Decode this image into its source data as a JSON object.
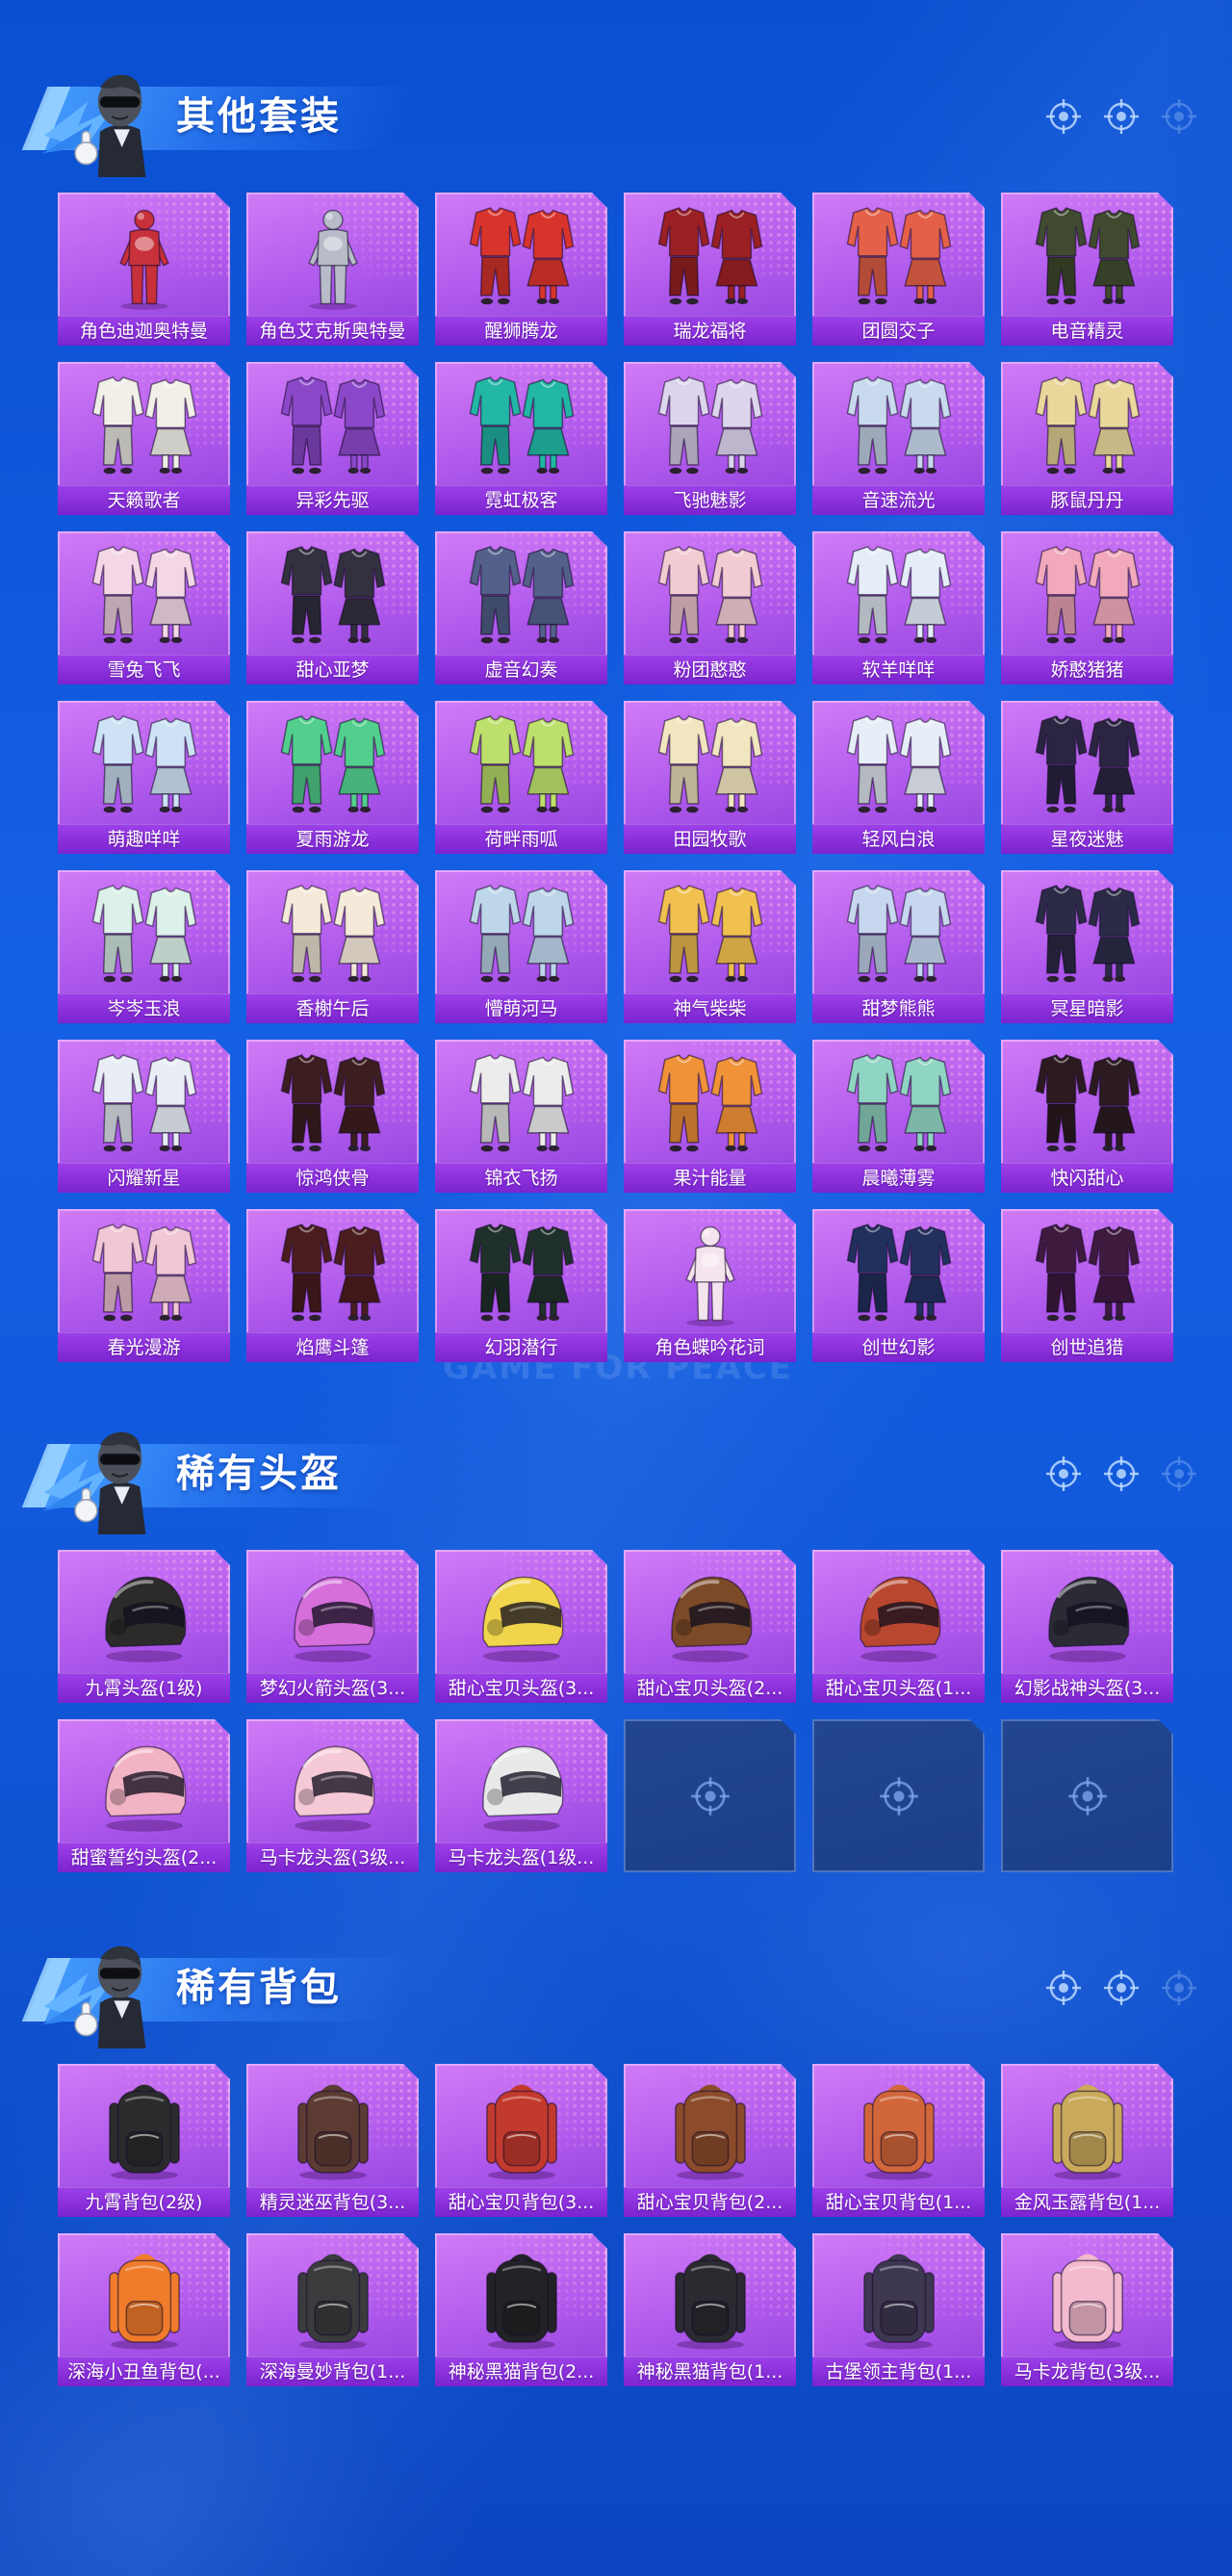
{
  "watermark": "GAME FOR PEACE",
  "colors": {
    "page_bg_top": "#0b4fd1",
    "page_bg_bottom": "#0c46c0",
    "card_top": "#d07bf6",
    "card_bottom": "#8f3fdc",
    "label_bg": "#7a24cf",
    "empty_slot": "#1c3f8a"
  },
  "header": {
    "mascot_icon": "mascot-icon",
    "marker_icons": [
      "target-icon",
      "target-icon",
      "target-icon"
    ]
  },
  "sections": [
    {
      "title": "其他套装",
      "items": [
        {
          "label": "角色迪迦奥特曼",
          "icon": "character-icon",
          "tint": "#c8303a"
        },
        {
          "label": "角色艾克斯奥特曼",
          "icon": "character-icon",
          "tint": "#b7bcc8"
        },
        {
          "label": "醒狮腾龙",
          "icon": "outfit-icon",
          "tint": "#d8342c"
        },
        {
          "label": "瑞龙福将",
          "icon": "outfit-icon",
          "tint": "#9a2024"
        },
        {
          "label": "团圆交子",
          "icon": "outfit-icon",
          "tint": "#e46048"
        },
        {
          "label": "电音精灵",
          "icon": "outfit-icon",
          "tint": "#3f4a2e"
        },
        {
          "label": "天籁歌者",
          "icon": "outfit-icon",
          "tint": "#f1efe8"
        },
        {
          "label": "异彩先驱",
          "icon": "outfit-icon",
          "tint": "#8a48c8"
        },
        {
          "label": "霓虹极客",
          "icon": "outfit-icon",
          "tint": "#22b7a4"
        },
        {
          "label": "飞驰魅影",
          "icon": "outfit-icon",
          "tint": "#ddd4ee"
        },
        {
          "label": "音速流光",
          "icon": "outfit-icon",
          "tint": "#c9d9ee"
        },
        {
          "label": "豚鼠丹丹",
          "icon": "outfit-icon",
          "tint": "#e9d79c"
        },
        {
          "label": "雪兔飞飞",
          "icon": "outfit-icon",
          "tint": "#f4d7e6"
        },
        {
          "label": "甜心亚梦",
          "icon": "outfit-icon",
          "tint": "#33303f"
        },
        {
          "label": "虚音幻奏",
          "icon": "outfit-icon",
          "tint": "#53608a"
        },
        {
          "label": "粉团憨憨",
          "icon": "outfit-icon",
          "tint": "#f2cbd3"
        },
        {
          "label": "软羊咩咩",
          "icon": "outfit-icon",
          "tint": "#e5eef8"
        },
        {
          "label": "娇憨猪猪",
          "icon": "outfit-icon",
          "tint": "#f1a9bb"
        },
        {
          "label": "萌趣咩咩",
          "icon": "outfit-icon",
          "tint": "#cde2f5"
        },
        {
          "label": "夏雨游龙",
          "icon": "outfit-icon",
          "tint": "#52cf8c"
        },
        {
          "label": "荷畔雨呱",
          "icon": "outfit-icon",
          "tint": "#bde06c"
        },
        {
          "label": "田园牧歌",
          "icon": "outfit-icon",
          "tint": "#f2e6c0"
        },
        {
          "label": "轻风白浪",
          "icon": "outfit-icon",
          "tint": "#e8eef8"
        },
        {
          "label": "星夜迷魅",
          "icon": "outfit-icon",
          "tint": "#2b2542"
        },
        {
          "label": "岑岑玉浪",
          "icon": "outfit-icon",
          "tint": "#dcf1ea"
        },
        {
          "label": "香榭午后",
          "icon": "outfit-icon",
          "tint": "#f5e9da"
        },
        {
          "label": "懵萌河马",
          "icon": "outfit-icon",
          "tint": "#bdd6ea"
        },
        {
          "label": "神气柴柴",
          "icon": "outfit-icon",
          "tint": "#f1c150"
        },
        {
          "label": "甜梦熊熊",
          "icon": "outfit-icon",
          "tint": "#c6d7ef"
        },
        {
          "label": "冥星暗影",
          "icon": "outfit-icon",
          "tint": "#2c2b47"
        },
        {
          "label": "闪耀新星",
          "icon": "outfit-icon",
          "tint": "#e8edf6"
        },
        {
          "label": "惊鸿侠骨",
          "icon": "outfit-icon",
          "tint": "#3d1e20"
        },
        {
          "label": "锦衣飞扬",
          "icon": "outfit-icon",
          "tint": "#ececec"
        },
        {
          "label": "果汁能量",
          "icon": "outfit-icon",
          "tint": "#f09238"
        },
        {
          "label": "晨曦薄雾",
          "icon": "outfit-icon",
          "tint": "#90d4c3"
        },
        {
          "label": "快闪甜心",
          "icon": "outfit-icon",
          "tint": "#2b1b21"
        },
        {
          "label": "春光漫游",
          "icon": "outfit-icon",
          "tint": "#f1c7d6"
        },
        {
          "label": "焰鹰斗篷",
          "icon": "outfit-icon",
          "tint": "#4b1d1f"
        },
        {
          "label": "幻羽潜行",
          "icon": "outfit-icon",
          "tint": "#20302a"
        },
        {
          "label": "角色蝶吟花词",
          "icon": "character-icon",
          "tint": "#f4e4ee"
        },
        {
          "label": "创世幻影",
          "icon": "outfit-icon",
          "tint": "#22305e"
        },
        {
          "label": "创世追猎",
          "icon": "outfit-icon",
          "tint": "#3e1a3f"
        }
      ]
    },
    {
      "title": "稀有头盔",
      "items": [
        {
          "label": "九霄头盔(1级)",
          "icon": "helmet-icon",
          "tint": "#2c2b2a"
        },
        {
          "label": "梦幻火箭头盔(3...",
          "icon": "helmet-icon",
          "tint": "#d66fdc"
        },
        {
          "label": "甜心宝贝头盔(3...",
          "icon": "helmet-icon",
          "tint": "#f0d44c"
        },
        {
          "label": "甜心宝贝头盔(2...",
          "icon": "helmet-icon",
          "tint": "#7c4a29"
        },
        {
          "label": "甜心宝贝头盔(1...",
          "icon": "helmet-icon",
          "tint": "#b9472f"
        },
        {
          "label": "幻影战神头盔(3...",
          "icon": "helmet-icon",
          "tint": "#2b2b36"
        },
        {
          "label": "甜蜜誓约头盔(2...",
          "icon": "helmet-icon",
          "tint": "#f2b3c5"
        },
        {
          "label": "马卡龙头盔(3级...",
          "icon": "helmet-icon",
          "tint": "#f6c9d7"
        },
        {
          "label": "马卡龙头盔(1级...",
          "icon": "helmet-icon",
          "tint": "#e9e9ea"
        },
        {
          "empty": true,
          "icon": "target-icon"
        },
        {
          "empty": true,
          "icon": "target-icon"
        },
        {
          "empty": true,
          "icon": "target-icon"
        }
      ]
    },
    {
      "title": "稀有背包",
      "items": [
        {
          "label": "九霄背包(2级)",
          "icon": "backpack-icon",
          "tint": "#2b2b2d"
        },
        {
          "label": "精灵迷巫背包(3...",
          "icon": "backpack-icon",
          "tint": "#5c3b33"
        },
        {
          "label": "甜心宝贝背包(3...",
          "icon": "backpack-icon",
          "tint": "#c23a2d"
        },
        {
          "label": "甜心宝贝背包(2...",
          "icon": "backpack-icon",
          "tint": "#8c4b2b"
        },
        {
          "label": "甜心宝贝背包(1...",
          "icon": "backpack-icon",
          "tint": "#d1663b"
        },
        {
          "label": "金风玉露背包(1...",
          "icon": "backpack-icon",
          "tint": "#caa95c"
        },
        {
          "label": "深海小丑鱼背包(...",
          "icon": "backpack-icon",
          "tint": "#f07b2b"
        },
        {
          "label": "深海曼妙背包(1...",
          "icon": "backpack-icon",
          "tint": "#3b3b3e"
        },
        {
          "label": "神秘黑猫背包(2...",
          "icon": "backpack-icon",
          "tint": "#232226"
        },
        {
          "label": "神秘黑猫背包(1...",
          "icon": "backpack-icon",
          "tint": "#2b2a30"
        },
        {
          "label": "古堡领主背包(1...",
          "icon": "backpack-icon",
          "tint": "#3e3751"
        },
        {
          "label": "马卡龙背包(3级...",
          "icon": "backpack-icon",
          "tint": "#f3b9cd"
        }
      ]
    }
  ]
}
